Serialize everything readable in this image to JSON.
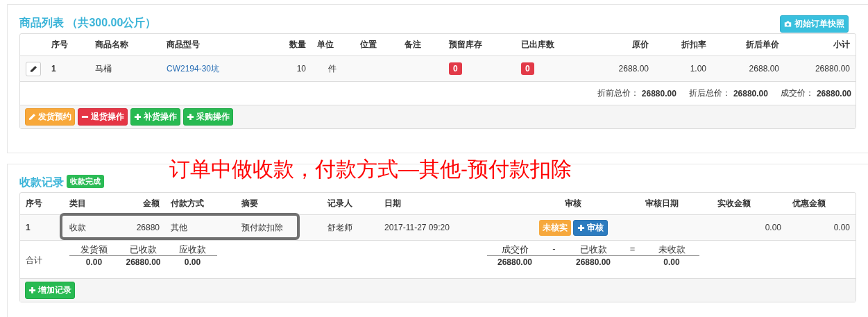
{
  "goods": {
    "title": "商品列表 （共300.00公斤）",
    "snapshot_button": "初始订单快照",
    "columns": [
      "序号",
      "商品名称",
      "商品型号",
      "数量",
      "单位",
      "位置",
      "备注",
      "预留库存",
      "已出库数",
      "原价",
      "折扣率",
      "折后单价",
      "小计"
    ],
    "rows": [
      {
        "seq": "1",
        "name": "马桶",
        "model": "CW2194-30坑",
        "qty": "10",
        "unit": "件",
        "reserved": "0",
        "shipped": "0",
        "price": "2688.00",
        "discount": "1.00",
        "net_price": "2688.00",
        "subtotal": "26880.00"
      }
    ],
    "totals": [
      {
        "label": "折前总价：",
        "value": "26880.00"
      },
      {
        "label": "折后总价：",
        "value": "26880.00"
      },
      {
        "label": "成交价：",
        "value": "26880.00"
      }
    ],
    "actions": [
      {
        "label": "发货预约",
        "kind": "edit"
      },
      {
        "label": "退货操作",
        "kind": "remove"
      },
      {
        "label": "补货操作",
        "kind": "add"
      },
      {
        "label": "采购操作",
        "kind": "add"
      }
    ]
  },
  "annotation": "订单中做收款，付款方式—其他-预付款扣除",
  "payments": {
    "title": "收款记录",
    "status_badge": "收款完成",
    "columns": [
      "序号",
      "类目",
      "金额",
      "付款方式",
      "摘要",
      "记录人",
      "日期",
      "审核",
      "审核日期",
      "实收金额",
      "优惠金额"
    ],
    "rows": [
      {
        "seq": "1",
        "category": "收款",
        "amount": "26880",
        "method": "其他",
        "summary": "预付款扣除",
        "recorder": "舒老师",
        "date": "2017-11-27 09:20",
        "status": "未核实",
        "review_button": "审核",
        "received": "0.00",
        "discount": "0.00"
      }
    ],
    "total_label": "合计",
    "summary_left": [
      {
        "label": "发货额",
        "value": "0.00"
      },
      {
        "label": "已收款",
        "value": "26880.00"
      },
      {
        "label": "应收款",
        "value": "0.00"
      }
    ],
    "summary_right": [
      {
        "label": "成交价",
        "value": "26880.00"
      },
      {
        "label": "-"
      },
      {
        "label": "已收款",
        "value": "26880.00"
      },
      {
        "label": "="
      },
      {
        "label": "未收款",
        "value": "0.00"
      }
    ],
    "add_button": "增加记录"
  }
}
